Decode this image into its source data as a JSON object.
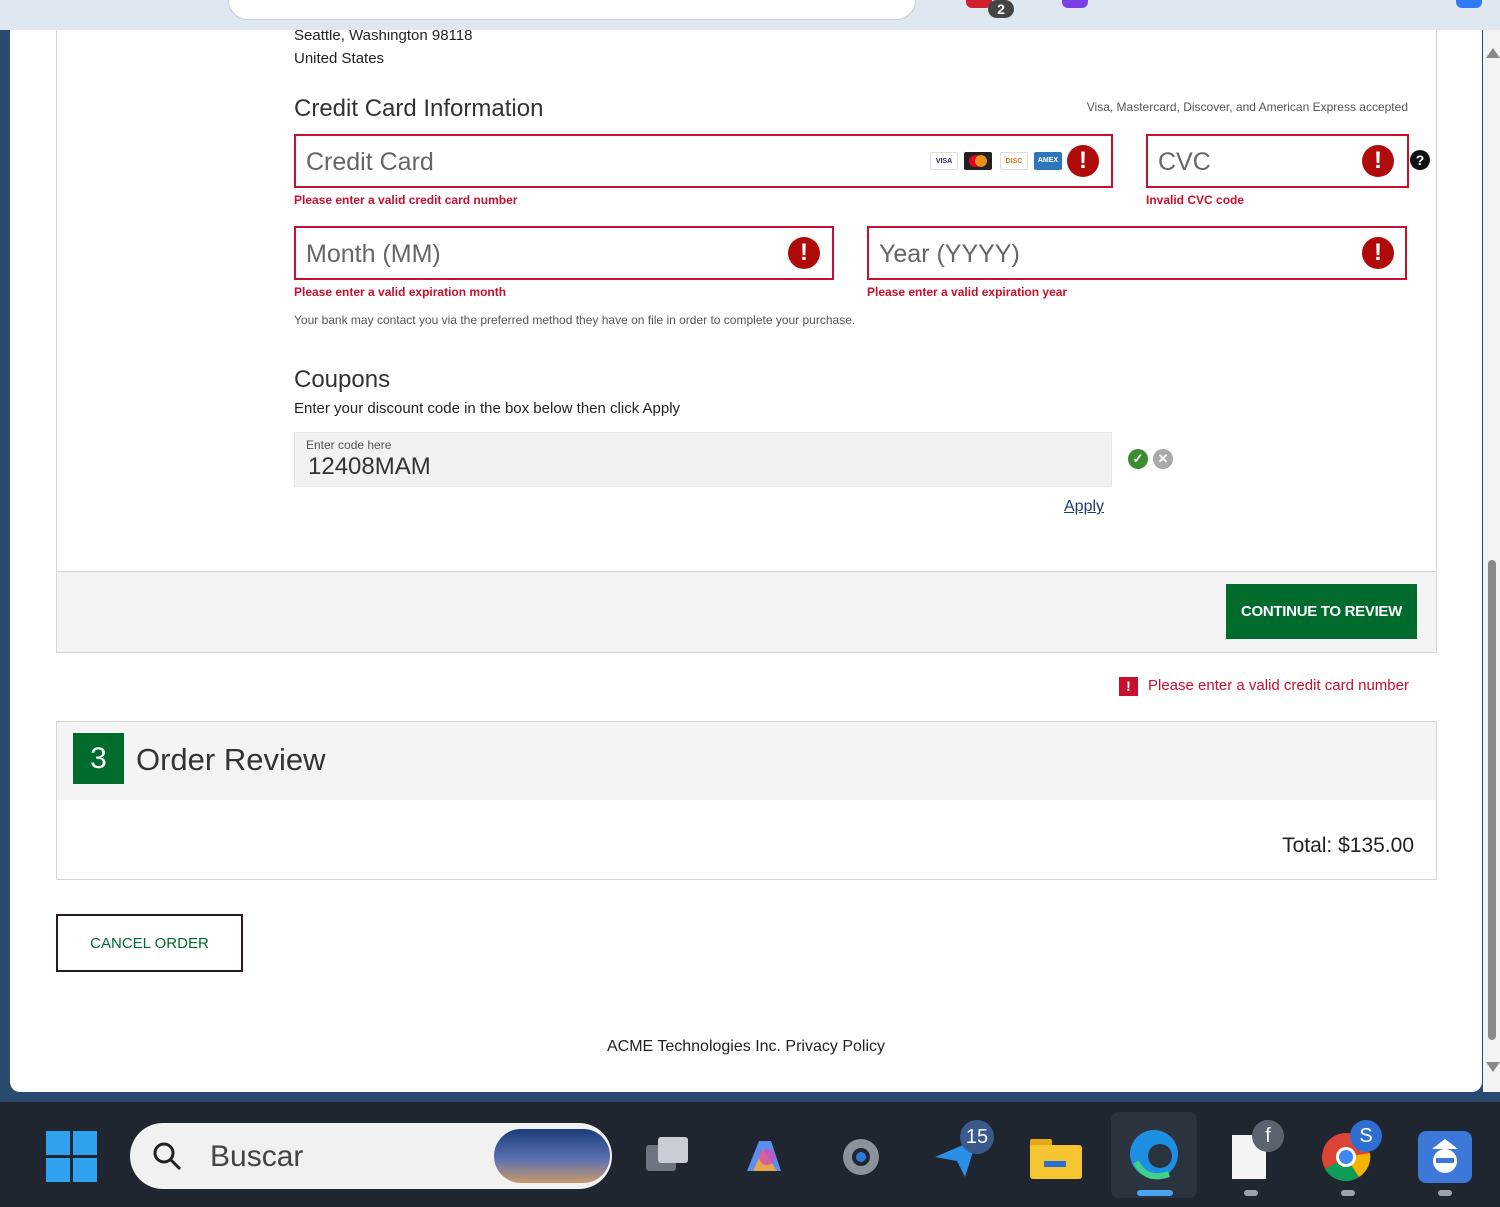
{
  "browser": {
    "notification_badge": "2"
  },
  "shipping_address": {
    "line_city": "Seattle, Washington 98118",
    "line_country": "United States"
  },
  "credit_card": {
    "heading": "Credit Card Information",
    "accepted_note": "Visa, Mastercard, Discover, and American Express accepted",
    "card_placeholder": "Credit Card",
    "card_error": "Please enter a valid credit card number",
    "cvc_placeholder": "CVC",
    "cvc_error": "Invalid CVC code",
    "month_placeholder": "Month (MM)",
    "month_error": "Please enter a valid expiration month",
    "year_placeholder": "Year (YYYY)",
    "year_error": "Please enter a valid expiration year",
    "bank_note": "Your bank may contact you via the preferred method they have on file in order to complete your purchase.",
    "card_brands": [
      "VISA",
      "MC",
      "DISC",
      "AMEX"
    ]
  },
  "coupons": {
    "heading": "Coupons",
    "instructions": "Enter your discount code in the box below then click Apply",
    "field_label": "Enter code here",
    "field_value": "12408MAM",
    "apply_label": "Apply"
  },
  "actions": {
    "continue_label": "CONTINUE TO REVIEW",
    "alert_message": "Please enter a valid credit card number",
    "cancel_label": "CANCEL ORDER"
  },
  "order_review": {
    "step_number": "3",
    "title": "Order Review",
    "total": "Total: $135.00"
  },
  "footer": {
    "text": "ACME Technologies Inc. Privacy Policy"
  },
  "taskbar": {
    "search_placeholder": "Buscar",
    "messages_badge": "15",
    "files_badge": "f",
    "chrome_badge": "S"
  },
  "colors": {
    "error": "#c8102e",
    "primary_green": "#006b2d",
    "taskbar": "#1f2630"
  }
}
